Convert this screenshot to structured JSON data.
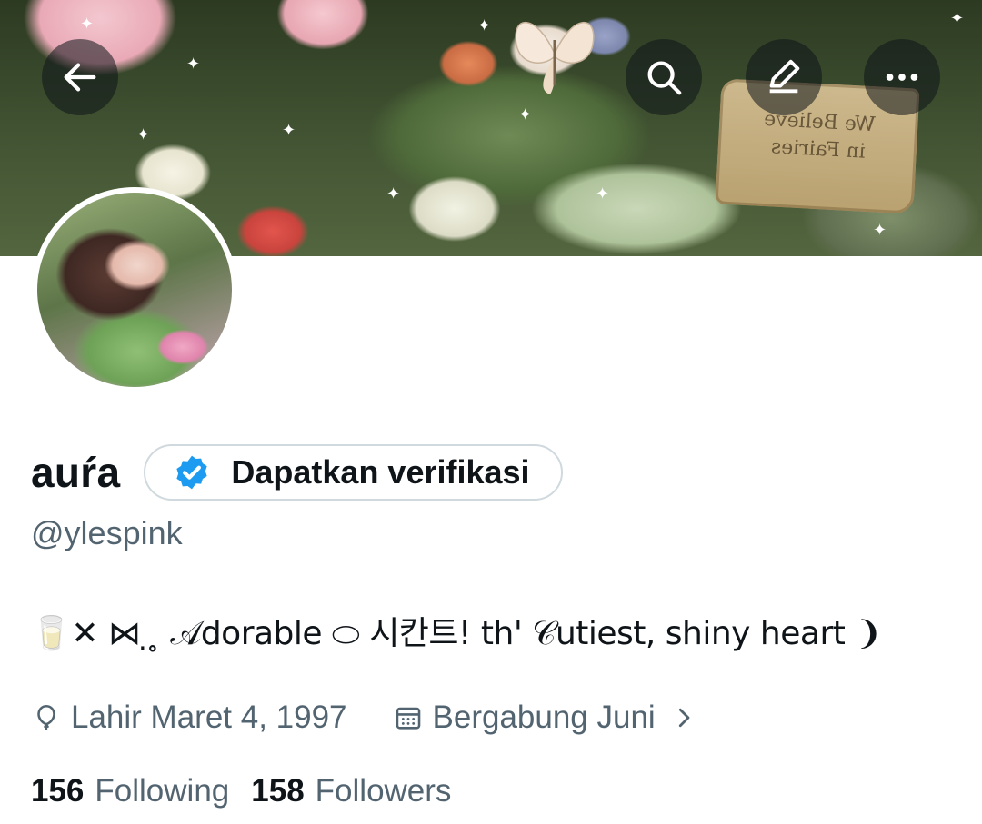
{
  "header": {
    "back_icon": "arrow-left-icon",
    "search_icon": "search-icon",
    "edit_icon": "pencil-icon",
    "more_icon": "more-horizontal-icon"
  },
  "profile": {
    "display_name": "auŕa",
    "handle": "@ylespink",
    "verify_label": "Dapatkan verifikasi",
    "verify_icon": "verified-badge-icon",
    "verify_color": "#1d9bf0",
    "bio": "🥛✕ ⋈ ̣ ̥ 𝒜dorable ⬭ 시칸트! th' 𝒞utiest, shiny heart ❩",
    "birth": "Lahir Maret 4, 1997",
    "birth_icon": "balloon-icon",
    "joined": "Bergabung Juni",
    "joined_icon": "calendar-icon",
    "following_count": "156",
    "following_label": "Following",
    "followers_count": "158",
    "followers_label": "Followers"
  },
  "banner": {
    "sign_text_line1": "We Believe",
    "sign_text_line2": "in Fairies"
  },
  "colors": {
    "text_primary": "#0f1419",
    "text_secondary": "#536471",
    "border": "#cfd9de",
    "overlay_button": "rgba(15,20,25,0.55)"
  }
}
